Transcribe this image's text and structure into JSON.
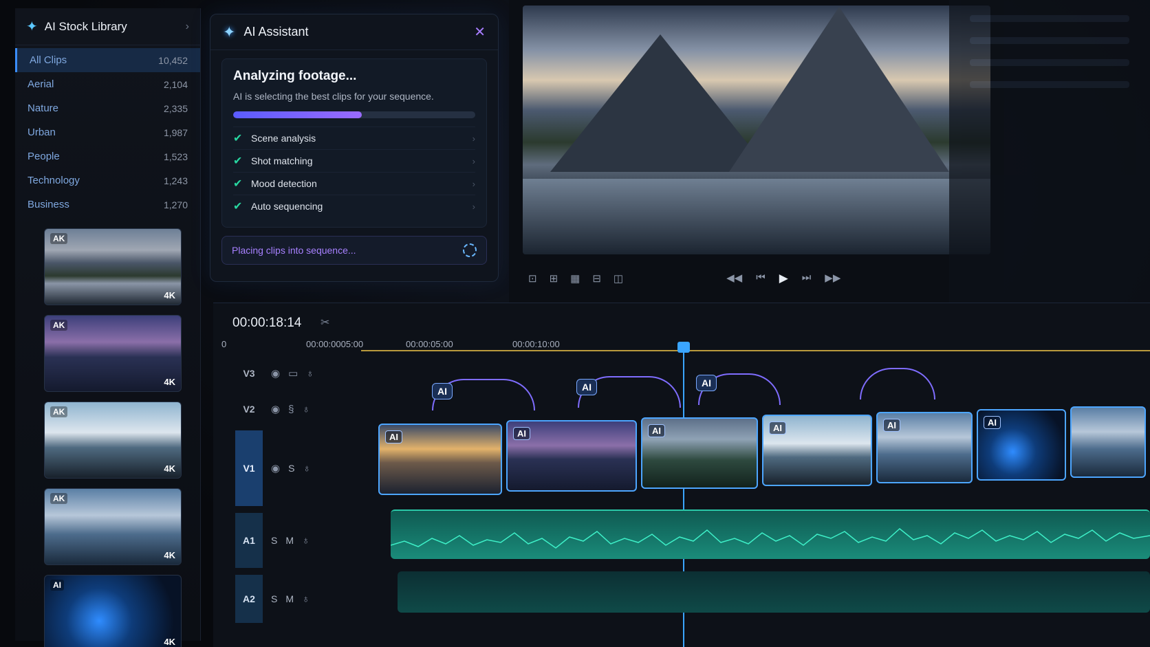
{
  "library": {
    "title": "AI Stock Library",
    "categories": [
      {
        "name": "All Clips",
        "count": "10,452"
      },
      {
        "name": "Aerial",
        "count": "2,104"
      },
      {
        "name": "Nature",
        "count": "2,335"
      },
      {
        "name": "Urban",
        "count": "1,987"
      },
      {
        "name": "People",
        "count": "1,523"
      },
      {
        "name": "Technology",
        "count": "1,243"
      },
      {
        "name": "Business",
        "count": "1,270"
      }
    ],
    "thumbnails": [
      {
        "tag": "AK",
        "res": "4K"
      },
      {
        "tag": "AK",
        "res": "4K"
      },
      {
        "tag": "AK",
        "res": "4K"
      },
      {
        "tag": "AK",
        "res": "4K"
      },
      {
        "tag": "AI",
        "res": "4K"
      }
    ]
  },
  "assistant": {
    "title": "AI Assistant",
    "status": "Analyzing footage...",
    "description": "AI is selecting the best clips for your sequence.",
    "progress": 0.53,
    "steps": [
      "Scene analysis",
      "Shot matching",
      "Mood detection",
      "Auto sequencing"
    ],
    "footer": "Placing clips into sequence..."
  },
  "timeline": {
    "timecode": "00:00:18:14",
    "ruler": {
      "start": "0",
      "r1": "00:00:0005:00",
      "r2": "00:00:05:00",
      "r3": "00:00:10:00"
    },
    "tracks": {
      "v3": "V3",
      "v2": "V2",
      "v1": "V1",
      "a1": "A1",
      "a2": "A2"
    },
    "track_buttons": {
      "s": "S",
      "m": "M"
    },
    "clip_badge": "AI"
  },
  "colors": {
    "accent": "#3a8dff",
    "purple": "#a780ff",
    "check": "#28d6a0",
    "audio": "#1a8c7a"
  }
}
